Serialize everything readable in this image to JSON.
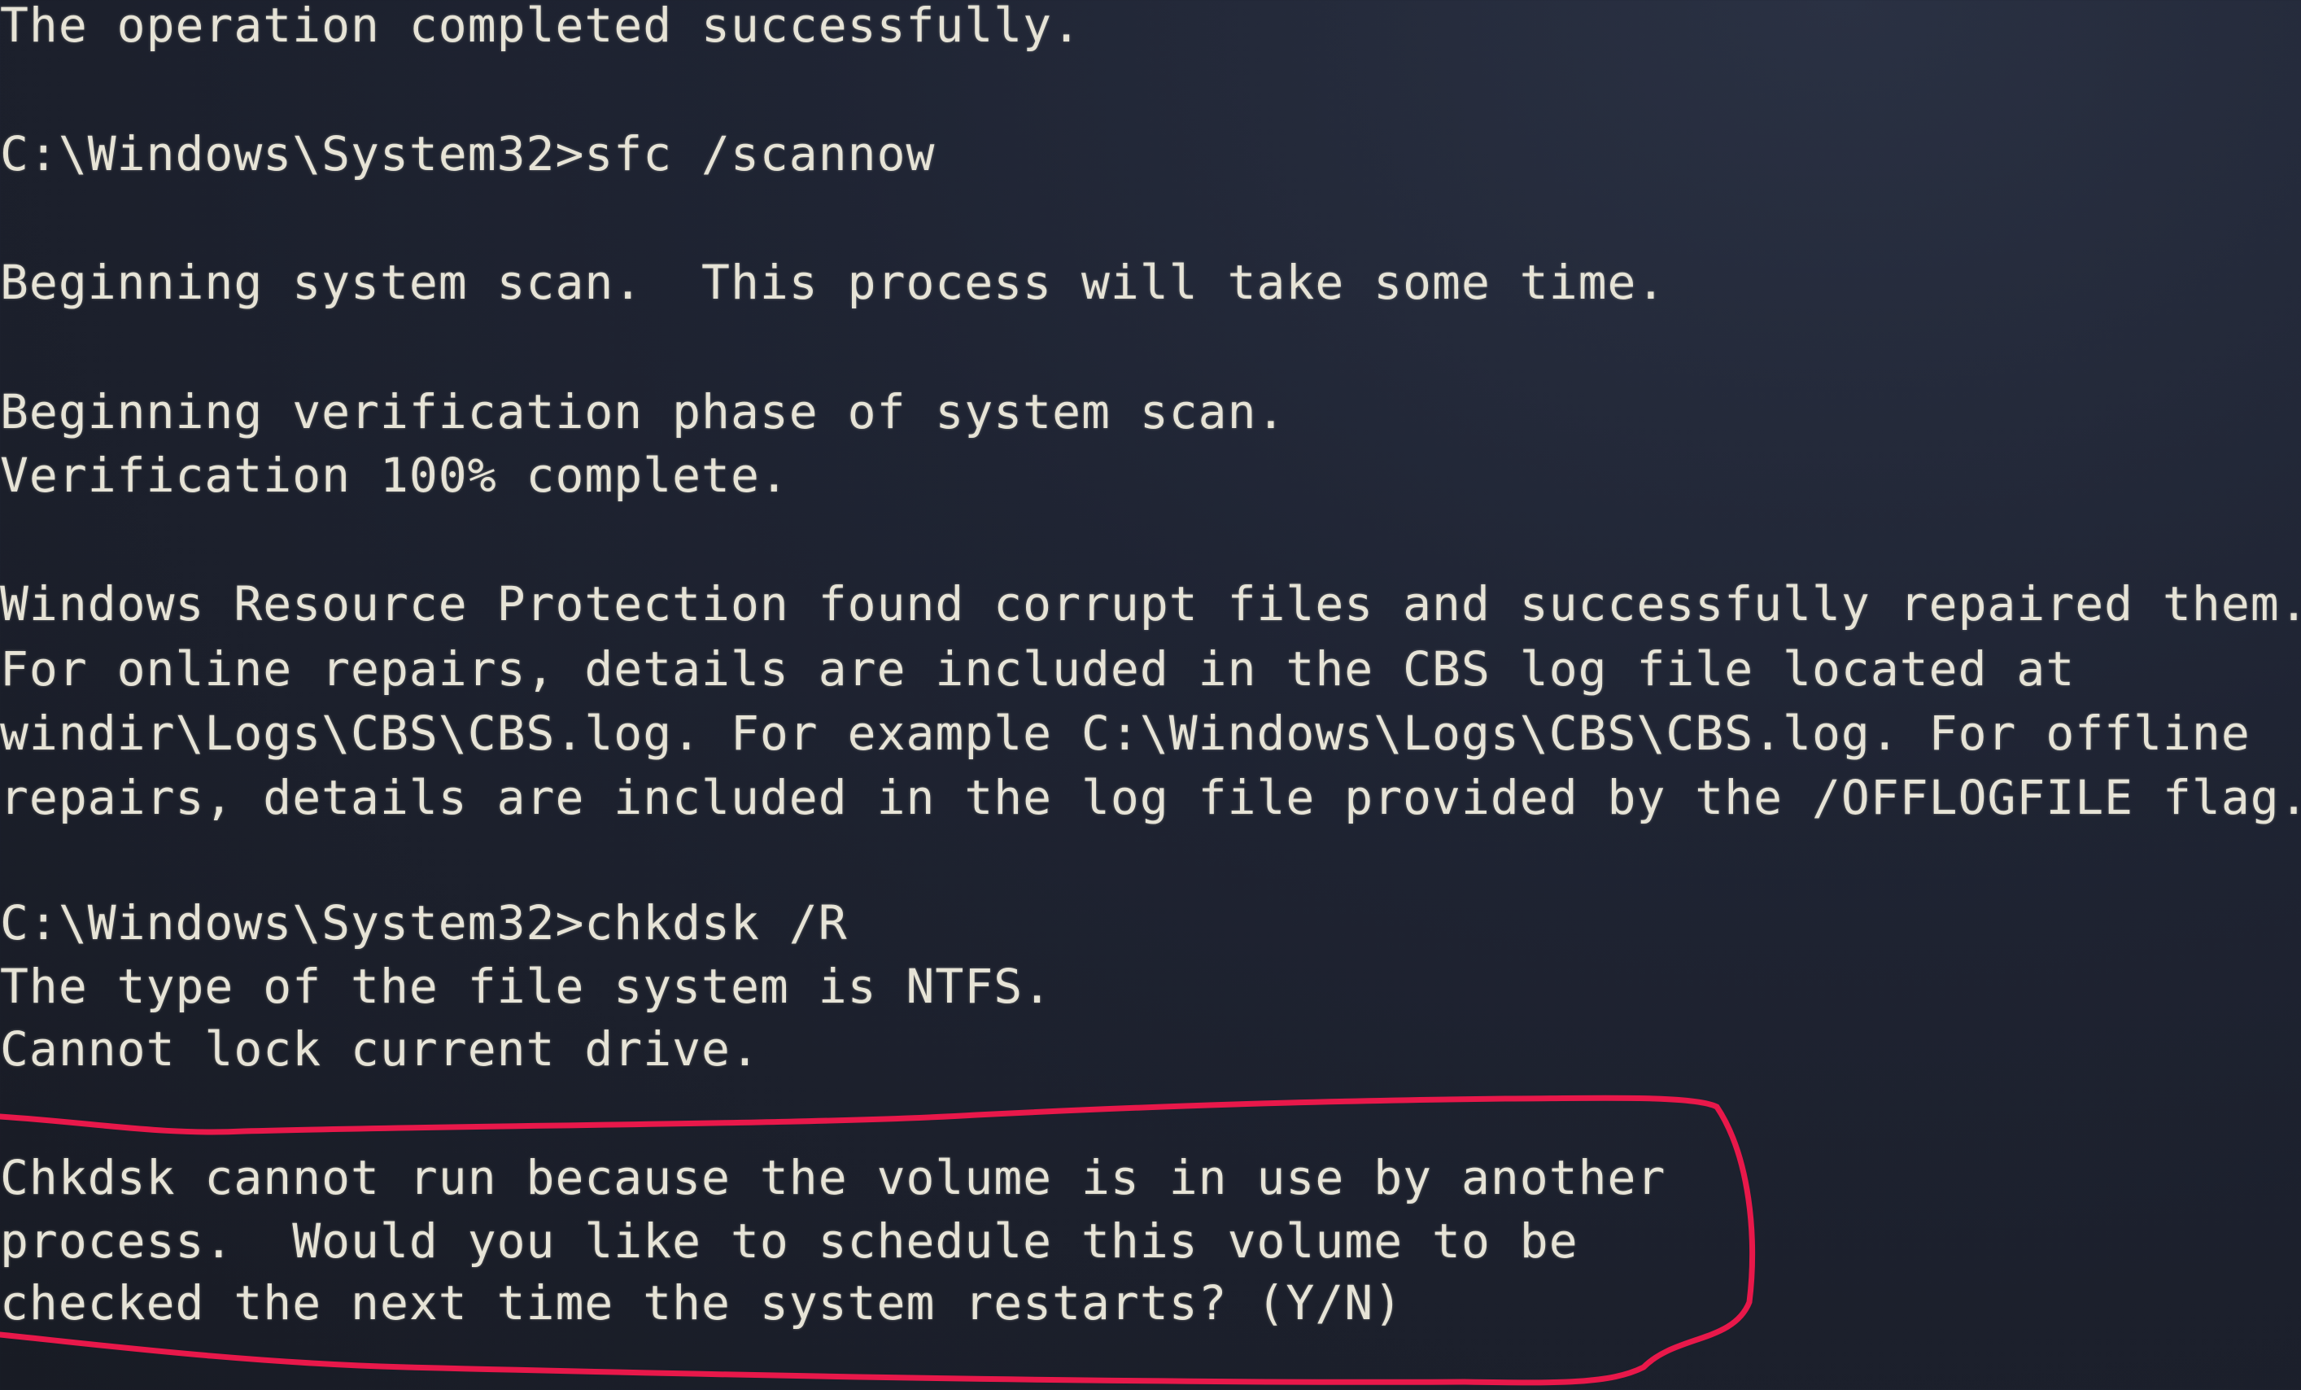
{
  "terminal": {
    "lines": [
      "The operation completed successfully.",
      "C:\\Windows\\System32>sfc /scannow",
      "Beginning system scan.  This process will take some time.",
      "Beginning verification phase of system scan.",
      "Verification 100% complete.",
      "Windows Resource Protection found corrupt files and successfully repaired them.",
      "For online repairs, details are included in the CBS log file located at",
      "windir\\Logs\\CBS\\CBS.log. For example C:\\Windows\\Logs\\CBS\\CBS.log. For offline",
      "repairs, details are included in the log file provided by the /OFFLOGFILE flag.",
      "C:\\Windows\\System32>chkdsk /R",
      "The type of the file system is NTFS.",
      "Cannot lock current drive.",
      "Chkdsk cannot run because the volume is in use by another",
      "process.  Would you like to schedule this volume to be",
      "checked the next time the system restarts? (Y/N)"
    ]
  },
  "annotation": {
    "color": "#e8184a"
  }
}
